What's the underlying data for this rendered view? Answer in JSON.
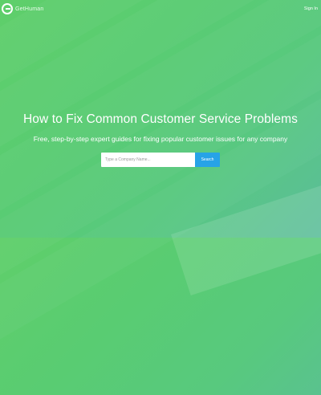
{
  "header": {
    "brand_name": "GetHuman",
    "signin_label": "Sign In"
  },
  "hero": {
    "headline": "How to Fix Common Customer Service Problems",
    "subtitle": "Free, step-by-step expert guides for fixing popular customer issues for any company"
  },
  "search": {
    "placeholder": "Type a Company Name...",
    "value": "",
    "button_label": "Search"
  },
  "colors": {
    "gradient_start": "#5fcf6a",
    "gradient_end": "#5bbd9a",
    "button": "#27a3e7",
    "text": "#ffffff"
  },
  "icons": {
    "logo": "gethuman-logo-icon"
  }
}
